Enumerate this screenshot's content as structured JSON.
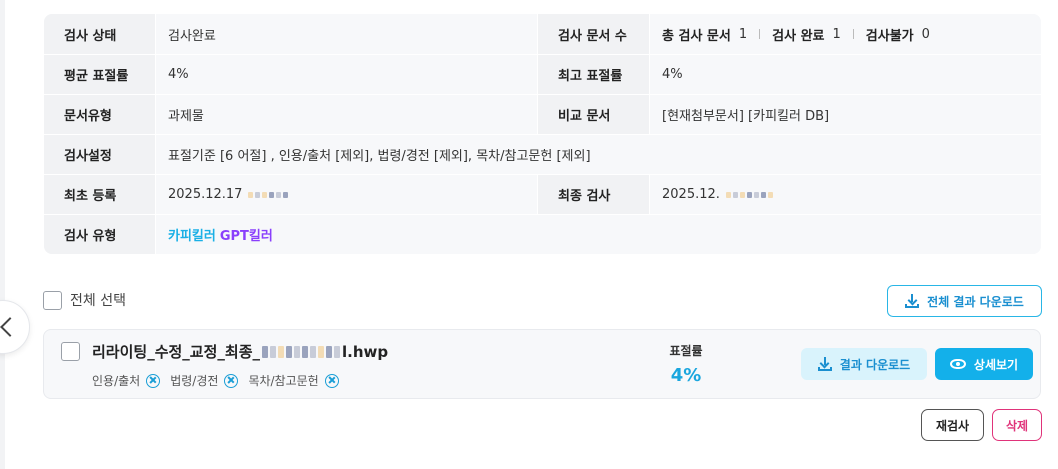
{
  "info": {
    "status_label": "검사 상태",
    "status_value": "검사완료",
    "doc_count_label": "검사 문서 수",
    "total_docs_label": "총 검사 문서",
    "total_docs_value": "1",
    "done_label": "검사 완료",
    "done_value": "1",
    "fail_label": "검사불가",
    "fail_value": "0",
    "avg_rate_label": "평균 표절률",
    "avg_rate_value": "4%",
    "max_rate_label": "최고 표절률",
    "max_rate_value": "4%",
    "doc_type_label": "문서유형",
    "doc_type_value": "과제물",
    "compare_label": "비교 문서",
    "compare_value": "[현재첨부문서] [카피킬러 DB]",
    "settings_label": "검사설정",
    "settings_value": "표절기준 [6 어절] , 인용/출처 [제외], 법령/경전 [제외], 목차/참고문헌 [제외]",
    "first_reg_label": "최초 등록",
    "first_reg_value": "2025.12.17",
    "last_check_label": "최종 검사",
    "last_check_value": "2025.12.",
    "check_type_label": "검사 유형",
    "check_type_copykiller": "카피킬러",
    "check_type_gpt": "GPT킬러"
  },
  "list": {
    "select_all_label": "전체 선택",
    "download_all_label": "전체 결과 다운로드"
  },
  "document": {
    "name_prefix": "리라이팅_수정_교정_최종_",
    "name_suffix": "l.hwp",
    "exclusions": [
      "인용/출처",
      "법령/경전",
      "목차/참고문헌"
    ],
    "rate_label": "표절률",
    "rate_value": "4%",
    "download_label": "결과 다운로드",
    "detail_label": "상세보기"
  },
  "actions": {
    "recheck_label": "재검사",
    "delete_label": "삭제"
  },
  "colors": {
    "accent": "#13b0ea",
    "copykiller": "#1ab0e6",
    "gptkiller": "#8a3ffc",
    "delete": "#e0337a"
  },
  "icons": {
    "back": "chevron-left-icon",
    "download": "download-icon",
    "detail": "eye-icon",
    "remove_exclusion": "x-circle-icon"
  }
}
